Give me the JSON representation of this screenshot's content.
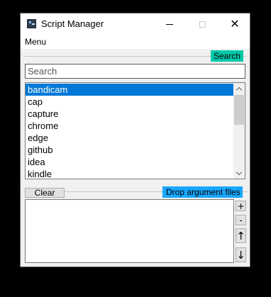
{
  "window": {
    "title": "Script Manager"
  },
  "menubar": {
    "menu_label": "Menu"
  },
  "search": {
    "badge_label": "Search",
    "placeholder": "Search",
    "value": ""
  },
  "scripts": {
    "items": [
      "bandicam",
      "cap",
      "capture",
      "chrome",
      "edge",
      "github",
      "idea",
      "kindle"
    ],
    "selected": "bandicam"
  },
  "arguments": {
    "clear_label": "Clear",
    "drop_label": "Drop argument files",
    "value": "",
    "add_label": "+",
    "remove_label": "-",
    "move_up_label": "↑",
    "move_down_label": "↓"
  },
  "colors": {
    "search_badge": "#00c9a8",
    "drop_badge": "#1aa8ff",
    "selection": "#0078d7"
  },
  "icons": {
    "app": "script-manager-app-icon",
    "minimize": "minimize-icon",
    "maximize": "maximize-icon",
    "close": "close-icon",
    "scroll_up": "chevron-up-icon",
    "scroll_down": "chevron-down-icon"
  }
}
